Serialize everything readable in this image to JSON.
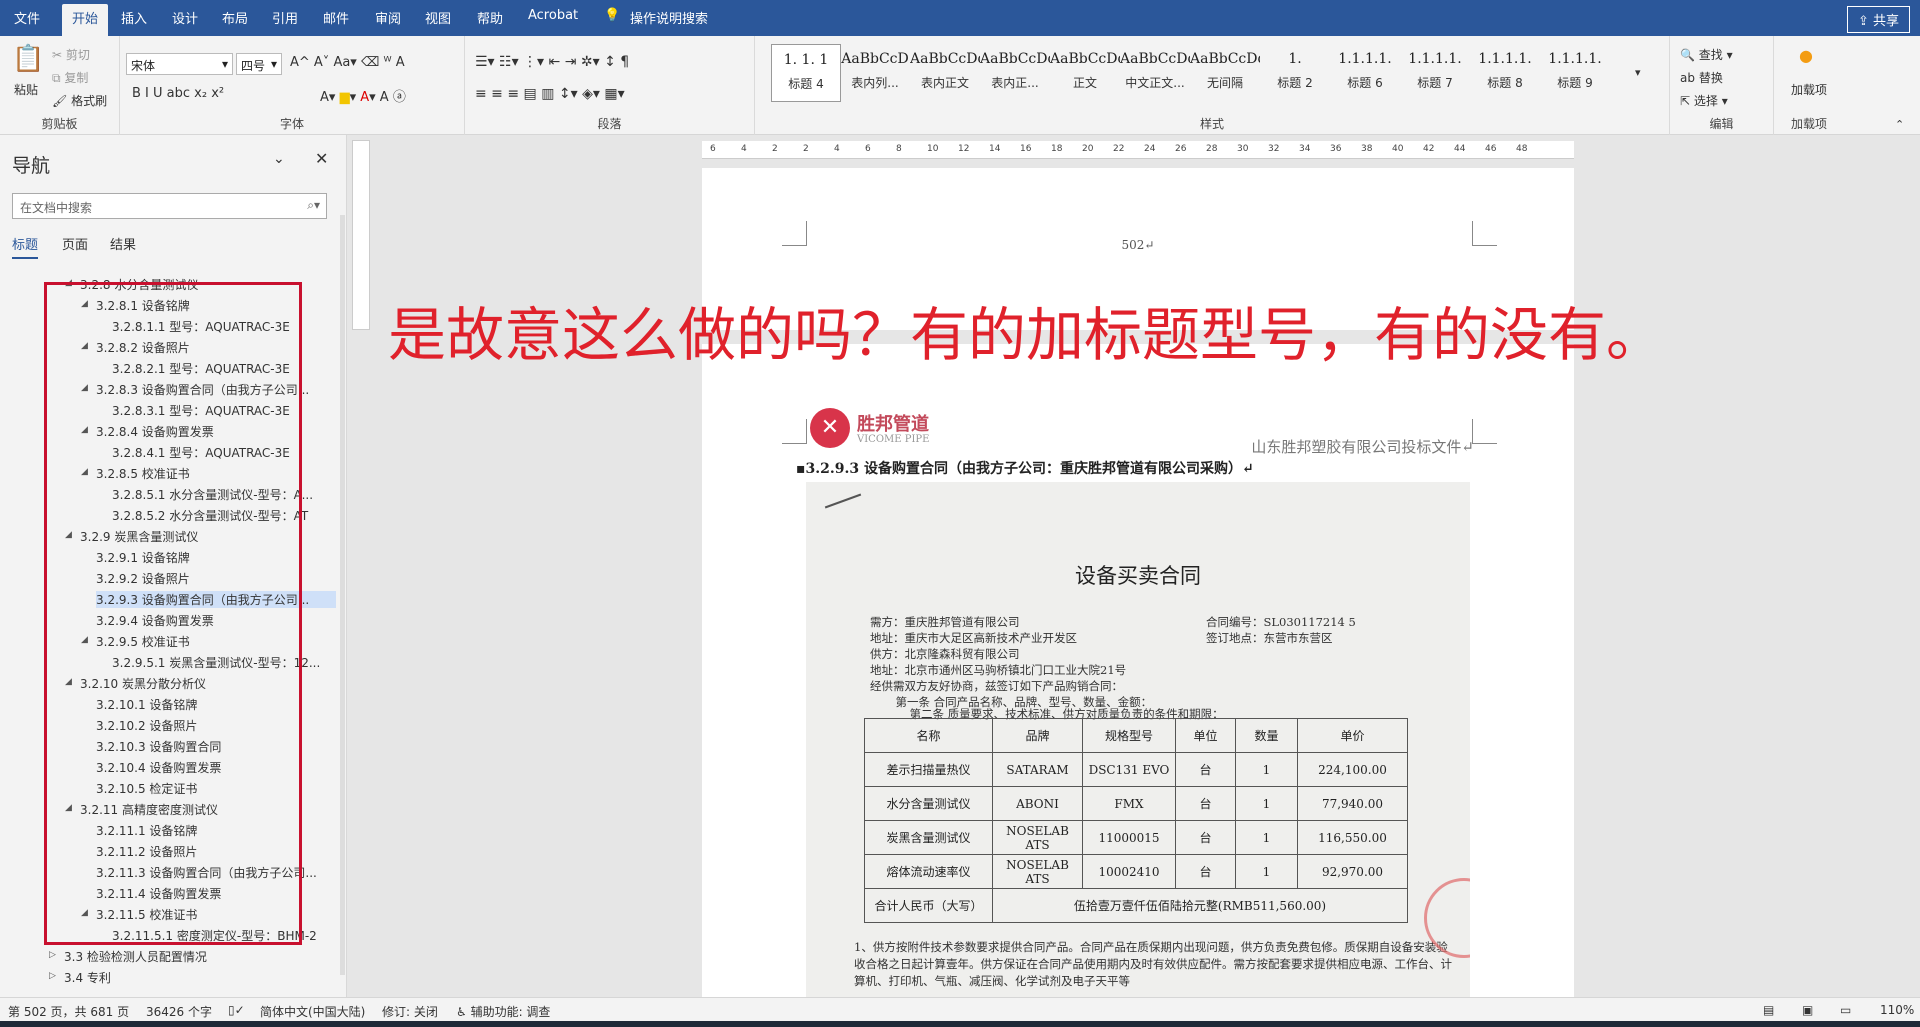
{
  "tabs": [
    "文件",
    "开始",
    "插入",
    "设计",
    "布局",
    "引用",
    "邮件",
    "审阅",
    "视图",
    "帮助",
    "Acrobat",
    "操作说明搜索"
  ],
  "share": "共享",
  "ribbon": {
    "clipboard": {
      "paste": "粘贴",
      "cut": "剪切",
      "copy": "复制",
      "format_painter": "格式刷",
      "label": "剪贴板"
    },
    "font": {
      "name": "宋体",
      "size": "四号",
      "label": "字体",
      "row2": "B  I  U  abc  x₂  x²"
    },
    "paragraph": {
      "label": "段落"
    },
    "styles": {
      "label": "样式",
      "items": [
        {
          "preview": "1. 1. 1",
          "name": "标题 4"
        },
        {
          "preview": "AaBbCcD",
          "name": "表内列..."
        },
        {
          "preview": "AaBbCcDd",
          "name": "表内正文"
        },
        {
          "preview": "AaBbCcDd",
          "name": "表内正..."
        },
        {
          "preview": "AaBbCcDd",
          "name": "正文"
        },
        {
          "preview": "AaBbCcDd",
          "name": "中文正文..."
        },
        {
          "preview": "AaBbCcDd",
          "name": "无间隔"
        },
        {
          "preview": "1.",
          "name": "标题 2"
        },
        {
          "preview": "1.1.1.1.",
          "name": "标题 6"
        },
        {
          "preview": "1.1.1.1.",
          "name": "标题 7"
        },
        {
          "preview": "1.1.1.1.",
          "name": "标题 8"
        },
        {
          "preview": "1.1.1.1.",
          "name": "标题 9"
        }
      ]
    },
    "editing": {
      "find": "查找",
      "replace": "替换",
      "select": "选择",
      "label": "编辑"
    },
    "addins": {
      "btn": "加载项",
      "label": "加载项"
    }
  },
  "nav": {
    "title": "导航",
    "search_placeholder": "在文档中搜索",
    "tabs": [
      "标题",
      "页面",
      "结果"
    ],
    "items": [
      "3.2.8 水分含量测试仪",
      "3.2.8.1 设备铭牌",
      "3.2.8.1.1 型号：AQUATRAC-3E",
      "3.2.8.2 设备照片",
      "3.2.8.2.1 型号：AQUATRAC-3E",
      "3.2.8.3 设备购置合同（由我方子公司...",
      "3.2.8.3.1 型号：AQUATRAC-3E",
      "3.2.8.4 设备购置发票",
      "3.2.8.4.1 型号：AQUATRAC-3E",
      "3.2.8.5 校准证书",
      "3.2.8.5.1 水分含量测试仪-型号：A...",
      "3.2.8.5.2 水分含量测试仪-型号：AT",
      "3.2.9 炭黑含量测试仪",
      "3.2.9.1 设备铭牌",
      "3.2.9.2 设备照片",
      "3.2.9.3 设备购置合同（由我方子公司...",
      "3.2.9.4 设备购置发票",
      "3.2.9.5 校准证书",
      "3.2.9.5.1 炭黑含量测试仪-型号：12...",
      "3.2.10 炭黑分散分析仪",
      "3.2.10.1 设备铭牌",
      "3.2.10.2 设备照片",
      "3.2.10.3 设备购置合同",
      "3.2.10.4 设备购置发票",
      "3.2.10.5 检定证书",
      "3.2.11 高精度密度测试仪",
      "3.2.11.1 设备铭牌",
      "3.2.11.2 设备照片",
      "3.2.11.3 设备购置合同（由我方子公司...",
      "3.2.11.4 设备购置发票",
      "3.2.11.5 校准证书",
      "3.2.11.5.1 密度测定仪-型号：BHM-2",
      "3.3 检验检测人员配置情况",
      "3.4 专利"
    ]
  },
  "ruler_ticks": [
    "6",
    "4",
    "2",
    "2",
    "4",
    "6",
    "8",
    "10",
    "12",
    "14",
    "16",
    "18",
    "20",
    "22",
    "24",
    "26",
    "28",
    "30",
    "32",
    "34",
    "36",
    "38",
    "40",
    "42",
    "44",
    "46",
    "48"
  ],
  "page": {
    "page_number": "502↵",
    "overlay": "是故意这么做的吗？有的加标题型号，有的没有。",
    "logo_cn": "胜邦管道",
    "logo_en": "VICOME PIPE",
    "header_right": "山东胜邦塑胶有限公司投标文件↵",
    "heading": "▪3.2.9.3  设备购置合同（由我方子公司：重庆胜邦管道有限公司采购）↵"
  },
  "contract": {
    "title": "设备买卖合同",
    "lines": [
      "需方：重庆胜邦管道有限公司",
      "地址：重庆市大足区高新技术产业开发区",
      "供方：北京隆森科贸有限公司",
      "地址：北京市通州区马驹桥镇北门口工业大院21号",
      "经供需双方友好协商，兹签订如下产品购销合同：",
      "　第一条  合同产品名称、品牌、型号、数量、金额：",
      "　第二条  质量要求、技术标准、供方对质量负责的条件和期限："
    ],
    "contract_no": "合同编号：SL030117214 5",
    "sign_place": "签订地点：东营市东营区",
    "headers": [
      "名称",
      "品牌",
      "规格型号",
      "单位",
      "数量",
      "单价"
    ],
    "rows": [
      [
        "差示扫描量热仪",
        "SATARAM",
        "DSC131 EVO",
        "台",
        "1",
        "224,100.00"
      ],
      [
        "水分含量测试仪",
        "ABONI",
        "FMX",
        "台",
        "1",
        "77,940.00"
      ],
      [
        "炭黑含量测试仪",
        "NOSELAB ATS",
        "11000015",
        "台",
        "1",
        "116,550.00"
      ],
      [
        "熔体流动速率仪",
        "NOSELAB ATS",
        "10002410",
        "台",
        "1",
        "92,970.00"
      ]
    ],
    "total_label": "合计人民币（大写）",
    "total_value": "伍拾壹万壹仟伍佰陆拾元整(RMB511,560.00)",
    "footer": "1、供方按附件技术参数要求提供合同产品。合同产品在质保期内出现问题，供方负责免费包修。质保期自设备安装验收合格之日起计算壹年。供方保证在合同产品使用期内及时有效供应配件。需方按配套要求提供相应电源、工作台、计算机、打印机、气瓶、减压阀、化学试剂及电子天平等"
  },
  "status": {
    "page": "第 502 页，共 681 页",
    "words": "36426 个字",
    "lang": "简体中文(中国大陆)",
    "track": "修订: 关闭",
    "access": "辅助功能: 调查",
    "zoom": "110%"
  }
}
